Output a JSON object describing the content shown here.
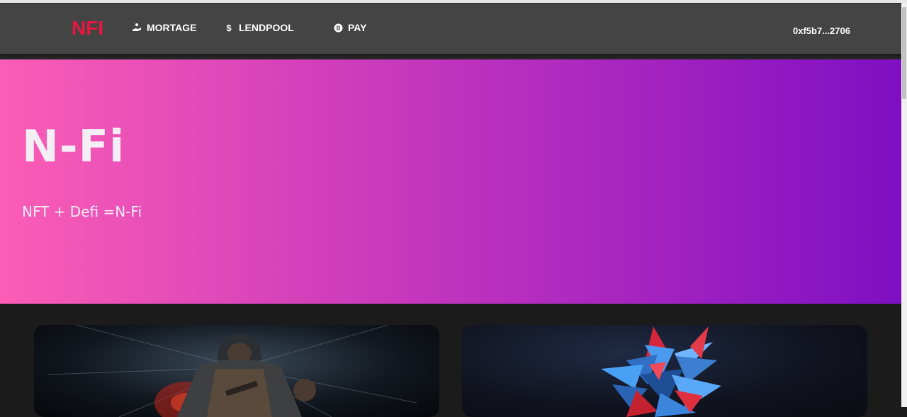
{
  "navbar": {
    "logo": "NFI",
    "items": [
      {
        "label": "MORTAGE",
        "icon": "mortgage-hand-icon"
      },
      {
        "label": "LENDPOOL",
        "icon": "dollar-icon"
      },
      {
        "label": "PAY",
        "icon": "bitcoin-icon"
      }
    ],
    "wallet": "0xf5b7...2706"
  },
  "hero": {
    "title": "N-Fi",
    "subtitle": "NFT + Defi =N-Fi"
  },
  "cards": [
    {
      "image": "assassin-character-artwork"
    },
    {
      "image": "abstract-crystal-artwork"
    }
  ],
  "colors": {
    "logo": "#e8173f",
    "navbar": "#444444",
    "hero_gradient_start": "#fc5db5",
    "hero_gradient_end": "#7f0fc3",
    "page_background": "#1b1b1b"
  }
}
